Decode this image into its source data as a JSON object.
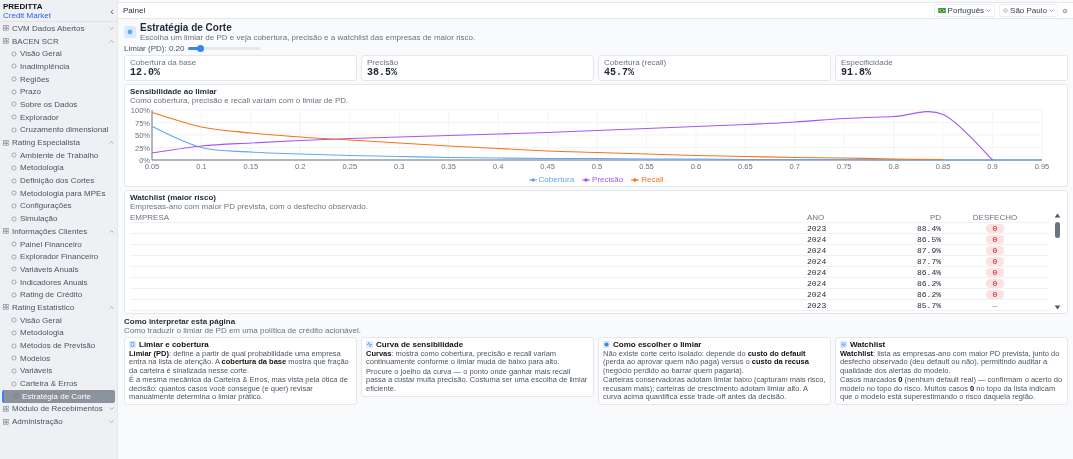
{
  "sidebar": {
    "brand": "PREDITTA",
    "subtitle": "Credit Market",
    "collapse": "‹",
    "groups": [
      {
        "label": "CVM Dados Abertos",
        "expanded": false
      },
      {
        "label": "BACEN SCR",
        "expanded": true,
        "children": [
          {
            "label": "Visão Geral",
            "selected": false
          },
          {
            "label": "Inadimplência",
            "selected": false
          },
          {
            "label": "Regiões",
            "selected": false
          },
          {
            "label": "Prazo",
            "selected": false
          },
          {
            "label": "Sobre os Dados",
            "selected": false
          },
          {
            "label": "Explorador",
            "selected": false
          },
          {
            "label": "Cruzamento dimensional",
            "selected": false
          }
        ]
      },
      {
        "label": "Rating Especialista",
        "expanded": true,
        "children": [
          {
            "label": "Ambiente de Trabalho",
            "selected": false
          },
          {
            "label": "Metodologia",
            "selected": false
          },
          {
            "label": "Definição dos Cortes",
            "selected": false
          },
          {
            "label": "Metodologia para MPEs",
            "selected": false
          },
          {
            "label": "Configurações",
            "selected": false
          },
          {
            "label": "Simulação",
            "selected": false
          }
        ]
      },
      {
        "label": "Informações Clientes",
        "expanded": true,
        "children": [
          {
            "label": "Painel Financeiro",
            "selected": false
          },
          {
            "label": "Explorador Financeiro",
            "selected": false
          },
          {
            "label": "Variáveis Anuais",
            "selected": false
          },
          {
            "label": "Indicadores Anuais",
            "selected": false
          },
          {
            "label": "Rating de Crédito",
            "selected": false
          }
        ]
      },
      {
        "label": "Rating Estatístico",
        "expanded": true,
        "children": [
          {
            "label": "Visão Geral",
            "selected": false
          },
          {
            "label": "Metodologia",
            "selected": false
          },
          {
            "label": "Métodos de Previsão",
            "selected": false
          },
          {
            "label": "Modelos",
            "selected": false
          },
          {
            "label": "Variáveis",
            "selected": false
          },
          {
            "label": "Carteira & Erros",
            "selected": false
          },
          {
            "label": "Estratégia de Corte",
            "selected": true
          }
        ]
      },
      {
        "label": "Módulo de Recebimentos",
        "expanded": false
      },
      {
        "label": "Administração",
        "expanded": false
      }
    ]
  },
  "topbar": {
    "breadcrumb": "Painel",
    "language": "Português",
    "timezone": "São Paulo"
  },
  "page": {
    "title": "Estratégia de Corte",
    "subtitle": "Escolha um limiar de PD e veja cobertura, precisão e a watchlist das empresas de maior risco.",
    "slider": {
      "label": "Limiar (PD): 0.20",
      "level": 0.17
    }
  },
  "metrics": [
    {
      "label": "Cobertura da base",
      "value": "12.0%"
    },
    {
      "label": "Precisão",
      "value": "38.5%"
    },
    {
      "label": "Cobertura (recall)",
      "value": "45.7%"
    },
    {
      "label": "Especificidade",
      "value": "91.8%"
    }
  ],
  "sensitivity": {
    "title": "Sensibilidade ao limiar",
    "subtitle": "Como cobertura, precisão e recall variam com o limiar de PD.",
    "chart_data": {
      "type": "line",
      "grid": true,
      "x": [
        0.05,
        0.1,
        0.15,
        0.2,
        0.25,
        0.3,
        0.35,
        0.4,
        0.45,
        0.5,
        0.55,
        0.6,
        0.65,
        0.7,
        0.75,
        0.8,
        0.85,
        0.9,
        0.95
      ],
      "xlim": [
        0.05,
        0.95
      ],
      "xticks": [
        0.05,
        0.1,
        0.15,
        0.2,
        0.25,
        0.3,
        0.35,
        0.4,
        0.45,
        0.5,
        0.55,
        0.6,
        0.65,
        0.7,
        0.75,
        0.8,
        0.85,
        0.9,
        0.95
      ],
      "ylim": [
        0,
        1
      ],
      "yticks": [
        {
          "value": 0,
          "label": "0%"
        },
        {
          "value": 0.25,
          "label": "25%"
        },
        {
          "value": 0.5,
          "label": "50%"
        },
        {
          "value": 0.75,
          "label": "75%"
        },
        {
          "value": 1,
          "label": "100%"
        }
      ],
      "series": [
        {
          "name": "Cobertura",
          "color": "#60a5fa",
          "values": [
            0.67,
            0.25,
            0.16,
            0.12,
            0.09,
            0.07,
            0.05,
            0.04,
            0.03,
            0.03,
            0.02,
            0.02,
            0.01,
            0.01,
            0.01,
            0,
            0,
            0,
            0
          ]
        },
        {
          "name": "Precisão",
          "color": "#a855f7",
          "values": [
            0.14,
            0.28,
            0.34,
            0.39,
            0.43,
            0.46,
            0.49,
            0.52,
            0.55,
            0.59,
            0.63,
            0.67,
            0.71,
            0.76,
            0.83,
            0.87,
            0.91,
            0,
            null
          ]
        },
        {
          "name": "Recall",
          "color": "#f97316",
          "values": [
            0.95,
            0.66,
            0.54,
            0.46,
            0.4,
            0.34,
            0.28,
            0.23,
            0.18,
            0.15,
            0.12,
            0.09,
            0.07,
            0.05,
            0.04,
            0.02,
            0.01,
            null,
            null
          ]
        }
      ]
    }
  },
  "watchlist": {
    "title": "Watchlist (maior risco)",
    "subtitle": "Empresas-ano com maior PD prevista, com o desfecho observado.",
    "columns": [
      "EMPRESA",
      "ANO",
      "PD",
      "DESFECHO"
    ],
    "rows": [
      {
        "year": "2023",
        "pd": "88.4%",
        "outcome": "0",
        "kind": "badge"
      },
      {
        "year": "2024",
        "pd": "86.5%",
        "outcome": "0",
        "kind": "badge"
      },
      {
        "year": "2024",
        "pd": "87.9%",
        "outcome": "0",
        "kind": "badge"
      },
      {
        "year": "2024",
        "pd": "87.7%",
        "outcome": "0",
        "kind": "badge"
      },
      {
        "year": "2024",
        "pd": "86.4%",
        "outcome": "0",
        "kind": "badge"
      },
      {
        "year": "2024",
        "pd": "86.2%",
        "outcome": "0",
        "kind": "badge"
      },
      {
        "year": "2024",
        "pd": "86.2%",
        "outcome": "0",
        "kind": "badge"
      },
      {
        "year": "2023",
        "pd": "85.7%",
        "outcome": "—",
        "kind": "text"
      }
    ]
  },
  "guide": {
    "title": "Como interpretar esta página",
    "subtitle": "Como traduzir o limiar de PD em uma política de crédito acionável.",
    "cards": [
      {
        "kind": "doc",
        "title": "Limiar e cobertura",
        "paragraphs": [
          "**Limiar (PD)**: define a partir de qual probabilidade uma empresa entra na lista de atenção. A **cobertura da base** mostra que fração da carteira é sinalizada nesse corte.",
          "É a mesma mecânica da Carteira & Erros, mas vista pela ótica de decisão: quantos casos você consegue (e quer) revisar manualmente determina o limiar prático."
        ]
      },
      {
        "kind": "pulse",
        "title": "Curva de sensibilidade",
        "paragraphs": [
          "**Curvas**: mostra como cobertura, precisão e recall variam continuamente conforme o limiar muda de baixo para alto.",
          "Procure o joelho da curva — o ponto onde ganhar mais recall passa a custar muita precisão. Costuma ser uma escolha de limiar eficiente."
        ]
      },
      {
        "kind": "info",
        "title": "Como escolher o limiar",
        "paragraphs": [
          "Não existe corte certo isolado: depende do **custo do default** (perda ao aprovar quem não paga) versus o **custo da recusa** (negócio perdido ao barrar quem pagaria).",
          "Carteiras conservadoras adotam limiar baixo (capturam mais risco, recusam mais); carteiras de crescimento adotam limiar alto. A curva acima quantifica esse trade-off antes da decisão."
        ]
      },
      {
        "kind": "list",
        "title": "Watchlist",
        "paragraphs": [
          "**Watchlist**: lista as empresas-ano com maior PD prevista, junto do desfecho observado (deu default ou não), permitindo auditar a qualidade dos alertas do modelo.",
          "Casos marcados **0** (nenhum default real) — confirmam o acerto do modelo no topo do risco. Muitos casos **0** no topo da lista indicam que o modelo está superestimando o risco daquela região."
        ]
      }
    ]
  }
}
